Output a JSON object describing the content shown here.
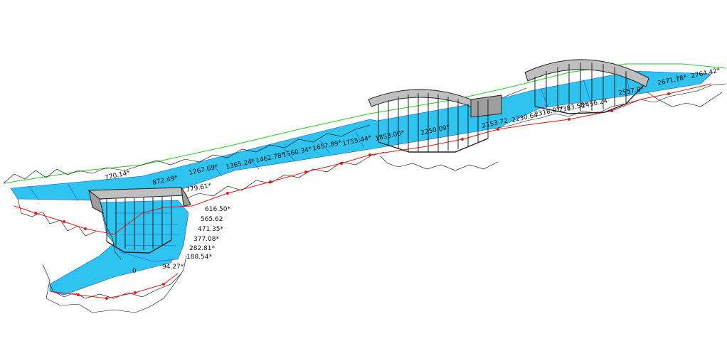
{
  "colors": {
    "water": "#2fc3ef",
    "water_line": "#1f4fd8",
    "terrain": "#000000",
    "profile": "#e41b1b",
    "bank": "#22cc22",
    "structure_fill": "#bfbfbf",
    "structure_edge": "#222222"
  },
  "labels_low": [
    "616.50*",
    "565.62",
    "471.35*",
    "377.08*",
    "282.81*",
    "188.54*",
    "94.27*",
    "0"
  ],
  "labels_upper": [
    "770.14*",
    "872.49*",
    "1267.69*",
    "1365.24*",
    "1462.78*",
    "1560.34*",
    "1657.89*",
    "1755.44*",
    "1853.00*"
  ],
  "labels_mid": [
    "2250.09*",
    "2153.72",
    "2230.64",
    "2318.07*",
    "2383.58*",
    "2456.24"
  ],
  "labels_top": [
    "2671.78*",
    "2764.42*"
  ],
  "labels_small": [
    "779.61*",
    "2557.8*"
  ]
}
